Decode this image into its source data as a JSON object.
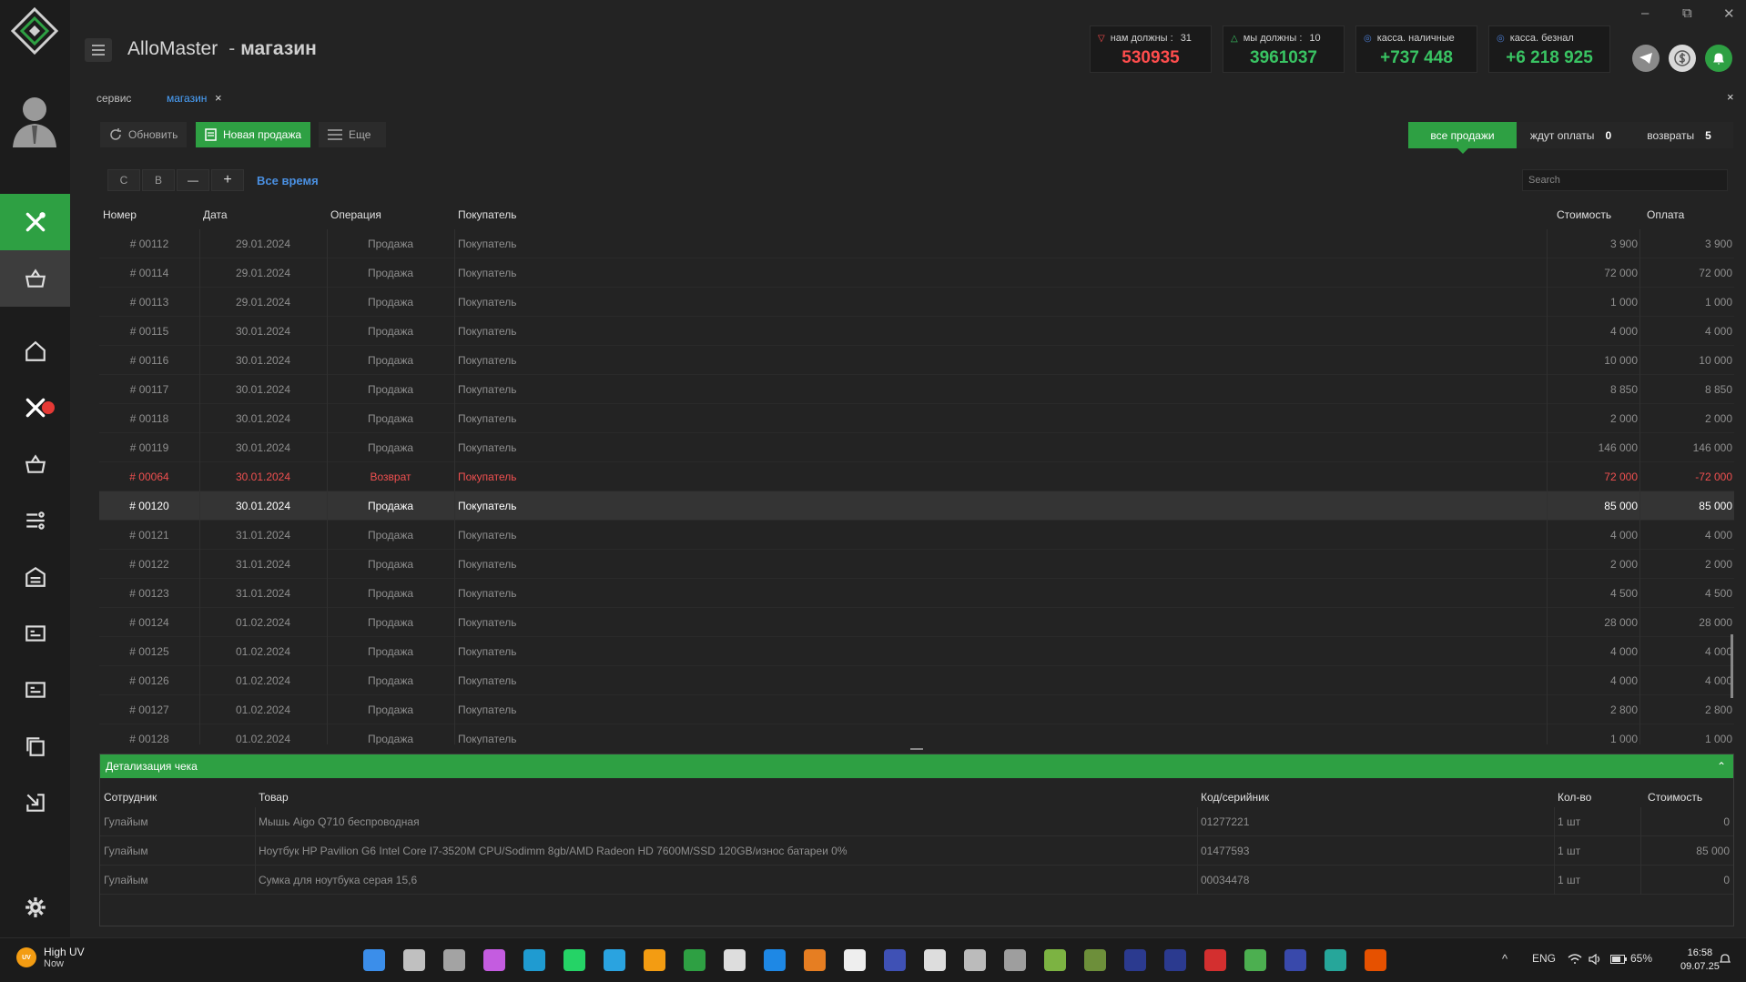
{
  "app": {
    "title": "AlloMaster",
    "separator": "-",
    "page": "магазин",
    "window_controls": {
      "minimize": "–",
      "restore": "⧉",
      "close": "✕"
    }
  },
  "stats": [
    {
      "label": "нам должны :",
      "count": "31",
      "value": "530935",
      "color": "#ff4d4d",
      "tri": "▽"
    },
    {
      "label": "мы должны :",
      "count": "10",
      "value": "3961037",
      "color": "#39c463",
      "tri": "△"
    },
    {
      "label": "касса. наличные",
      "count": "",
      "value": "+737 448",
      "color": "#39c463",
      "tri": "◎"
    },
    {
      "label": "касса. безнал",
      "count": "",
      "value": "+6 218 925",
      "color": "#39c463",
      "tri": "◎"
    }
  ],
  "tabs": [
    {
      "label": "сервис"
    },
    {
      "label": "магазин",
      "close": "×"
    }
  ],
  "close_panel": "×",
  "toolbar": {
    "refresh": "Обновить",
    "new_sale": "Новая продажа",
    "more": "Еще",
    "all_sales": "все продажи",
    "awaiting_payment": "ждут оплаты",
    "awaiting_count": "0",
    "returns": "возвраты",
    "returns_count": "5"
  },
  "filter": {
    "from": "С",
    "to": "В",
    "minus": "—",
    "plus": "+",
    "period": "Все время",
    "search_placeholder": "Search"
  },
  "table": {
    "headers": {
      "num": "Номер",
      "date": "Дата",
      "op": "Операция",
      "buyer": "Покупатель",
      "cost": "Стоимость",
      "pay": "Оплата"
    },
    "rows": [
      {
        "num": "# 00112",
        "date": "29.01.2024",
        "op": "Продажа",
        "buyer": "Покупатель",
        "cost": "3 900",
        "pay": "3 900"
      },
      {
        "num": "# 00114",
        "date": "29.01.2024",
        "op": "Продажа",
        "buyer": "Покупатель",
        "cost": "72 000",
        "pay": "72 000"
      },
      {
        "num": "# 00113",
        "date": "29.01.2024",
        "op": "Продажа",
        "buyer": "Покупатель",
        "cost": "1 000",
        "pay": "1 000"
      },
      {
        "num": "# 00115",
        "date": "30.01.2024",
        "op": "Продажа",
        "buyer": "Покупатель",
        "cost": "4 000",
        "pay": "4 000"
      },
      {
        "num": "# 00116",
        "date": "30.01.2024",
        "op": "Продажа",
        "buyer": "Покупатель",
        "cost": "10 000",
        "pay": "10 000"
      },
      {
        "num": "# 00117",
        "date": "30.01.2024",
        "op": "Продажа",
        "buyer": "Покупатель",
        "cost": "8 850",
        "pay": "8 850"
      },
      {
        "num": "# 00118",
        "date": "30.01.2024",
        "op": "Продажа",
        "buyer": "Покупатель",
        "cost": "2 000",
        "pay": "2 000"
      },
      {
        "num": "# 00119",
        "date": "30.01.2024",
        "op": "Продажа",
        "buyer": "Покупатель",
        "cost": "146 000",
        "pay": "146 000"
      },
      {
        "num": "# 00064",
        "date": "30.01.2024",
        "op": "Возврат",
        "buyer": "Покупатель",
        "cost": "72 000",
        "pay": "-72 000",
        "state": "ret"
      },
      {
        "num": "# 00120",
        "date": "30.01.2024",
        "op": "Продажа",
        "buyer": "Покупатель",
        "cost": "85 000",
        "pay": "85 000",
        "state": "sel"
      },
      {
        "num": "# 00121",
        "date": "31.01.2024",
        "op": "Продажа",
        "buyer": "Покупатель",
        "cost": "4 000",
        "pay": "4 000"
      },
      {
        "num": "# 00122",
        "date": "31.01.2024",
        "op": "Продажа",
        "buyer": "Покупатель",
        "cost": "2 000",
        "pay": "2 000"
      },
      {
        "num": "# 00123",
        "date": "31.01.2024",
        "op": "Продажа",
        "buyer": "Покупатель",
        "cost": "4 500",
        "pay": "4 500"
      },
      {
        "num": "# 00124",
        "date": "01.02.2024",
        "op": "Продажа",
        "buyer": "Покупатель",
        "cost": "28 000",
        "pay": "28 000"
      },
      {
        "num": "# 00125",
        "date": "01.02.2024",
        "op": "Продажа",
        "buyer": "Покупатель",
        "cost": "4 000",
        "pay": "4 000"
      },
      {
        "num": "# 00126",
        "date": "01.02.2024",
        "op": "Продажа",
        "buyer": "Покупатель",
        "cost": "4 000",
        "pay": "4 000"
      },
      {
        "num": "# 00127",
        "date": "01.02.2024",
        "op": "Продажа",
        "buyer": "Покупатель",
        "cost": "2 800",
        "pay": "2 800"
      },
      {
        "num": "# 00128",
        "date": "01.02.2024",
        "op": "Продажа",
        "buyer": "Покупатель",
        "cost": "1 000",
        "pay": "1 000"
      }
    ]
  },
  "detail": {
    "title": "Детализация чека",
    "chevron": "⌃",
    "headers": {
      "employee": "Сотрудник",
      "item": "Товар",
      "code": "Код/серийник",
      "qty": "Кол-во",
      "cost": "Стоимость"
    },
    "rows": [
      {
        "employee": "Гулайым",
        "item": "Мышь Aigo Q710 беспроводная",
        "code": "01277221",
        "qty": "1 шт",
        "cost": "0"
      },
      {
        "employee": "Гулайым",
        "item": "Ноутбук HP Pavilion G6 Intel Core I7-3520M CPU/Sodimm  8gb/AMD Radeon HD 7600M/SSD 120GB/износ батареи 0%",
        "code": "01477593",
        "qty": "1 шт",
        "cost": "85 000"
      },
      {
        "employee": "Гулайым",
        "item": "Сумка для ноутбука серая 15,6",
        "code": "00034478",
        "qty": "1 шт",
        "cost": "0"
      }
    ]
  },
  "taskbar": {
    "weather_badge": "UV",
    "weather_title": "High UV",
    "weather_sub": "Now",
    "lang": "ENG",
    "battery": "65%",
    "time": "16:58",
    "date": "09.07.25",
    "tray_arrow": "^",
    "apps": [
      "start-icon",
      "search-icon",
      "task-view-icon",
      "copilot-icon",
      "edge-icon",
      "whatsapp-icon",
      "telegram-icon",
      "sublime-icon",
      "allomaster-icon",
      "calculator-icon",
      "mail-icon",
      "paint-icon",
      "file-icon",
      "c-app-icon",
      "terminal-icon",
      "tool-icon",
      "vpn-icon",
      "ad-icon",
      "ot-icon",
      "cfx-icon",
      "cfx2-icon",
      "filezilla-icon",
      "gem-icon",
      "shell-icon",
      "infinity-icon",
      "firefox-icon"
    ]
  }
}
